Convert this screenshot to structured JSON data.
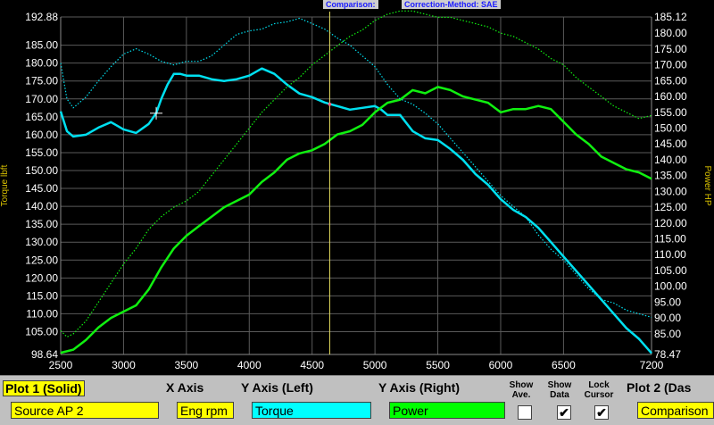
{
  "header": {
    "comparison_label": "Comparison:",
    "correction_label": "Correction-Method: SAE"
  },
  "colors": {
    "torque": "#00e0f0",
    "power": "#10f010",
    "cursor": "#e8e060",
    "grid": "#5a5a5a",
    "axis_label": "#d8c000"
  },
  "chart_data": {
    "type": "line",
    "xlim": [
      2500,
      7200
    ],
    "y_left_lim": [
      98.64,
      192.88
    ],
    "y_right_lim": [
      78.47,
      185.12
    ],
    "x_ticks": [
      2500,
      3000,
      3500,
      4000,
      4500,
      5000,
      5500,
      6000,
      6500,
      7200
    ],
    "y_left_ticks": [
      "192.88",
      "185.00",
      "180.00",
      "175.00",
      "170.00",
      "165.00",
      "160.00",
      "155.00",
      "150.00",
      "145.00",
      "140.00",
      "135.00",
      "130.00",
      "125.00",
      "120.00",
      "115.00",
      "110.00",
      "105.00",
      "98.64"
    ],
    "y_right_ticks": [
      "185.12",
      "180.00",
      "175.00",
      "170.00",
      "165.00",
      "160.00",
      "155.00",
      "150.00",
      "145.00",
      "140.00",
      "135.00",
      "130.00",
      "125.00",
      "120.00",
      "115.00",
      "110.00",
      "105.00",
      "100.00",
      "95.00",
      "90.00",
      "85.00",
      "78.47"
    ],
    "y_left_label": "Torque lbft",
    "y_right_label": "Power HP",
    "cursor_x": 4640,
    "grid": true,
    "series": [
      {
        "name": "Torque",
        "axis": "left",
        "style": "solid",
        "color": "#00e0f0",
        "x": [
          2500,
          2550,
          2600,
          2700,
          2800,
          2900,
          3000,
          3100,
          3200,
          3260,
          3300,
          3350,
          3400,
          3450,
          3500,
          3600,
          3700,
          3800,
          3900,
          4000,
          4100,
          4200,
          4300,
          4400,
          4500,
          4600,
          4700,
          4800,
          4900,
          5000,
          5050,
          5100,
          5200,
          5300,
          5400,
          5500,
          5600,
          5700,
          5800,
          5900,
          6000,
          6100,
          6200,
          6300,
          6400,
          6500,
          6600,
          6700,
          6800,
          6900,
          7000,
          7100,
          7200
        ],
        "y": [
          166.5,
          161,
          159.5,
          160,
          162,
          163.5,
          161.5,
          160.5,
          163,
          166,
          170,
          174,
          177,
          177,
          176.5,
          176.5,
          175.5,
          175,
          175.5,
          176.5,
          178.5,
          177,
          174,
          171.5,
          170.5,
          169,
          168,
          167,
          167.5,
          168,
          167,
          165.5,
          165.5,
          161,
          159,
          158.5,
          156,
          153,
          149,
          146,
          142,
          139,
          137,
          134,
          130,
          126,
          122,
          118,
          114,
          110,
          106,
          103,
          99
        ]
      },
      {
        "name": "Power",
        "axis": "right",
        "style": "solid",
        "color": "#10f010",
        "x": [
          2500,
          2600,
          2700,
          2800,
          2900,
          3000,
          3100,
          3200,
          3300,
          3400,
          3500,
          3600,
          3700,
          3800,
          3900,
          4000,
          4100,
          4200,
          4300,
          4400,
          4500,
          4600,
          4700,
          4800,
          4900,
          5000,
          5100,
          5200,
          5300,
          5400,
          5500,
          5600,
          5700,
          5800,
          5900,
          6000,
          6100,
          6200,
          6300,
          6400,
          6500,
          6600,
          6700,
          6800,
          6900,
          7000,
          7100,
          7200
        ],
        "y": [
          79,
          80,
          83,
          87,
          90,
          92,
          94,
          99,
          106,
          112,
          116,
          119,
          122,
          125,
          127,
          129,
          133,
          136,
          140,
          142,
          143,
          145,
          148,
          149,
          151,
          155,
          158,
          159,
          162,
          161,
          163,
          162,
          160,
          159,
          158,
          155,
          156,
          156,
          157,
          156,
          152,
          148,
          145,
          141,
          139,
          137,
          136,
          134
        ]
      },
      {
        "name": "",
        "axis": "left",
        "style": "dotted",
        "color": "#00e0f0",
        "x": [
          2500,
          2550,
          2600,
          2700,
          2800,
          2900,
          3000,
          3100,
          3200,
          3300,
          3400,
          3500,
          3600,
          3700,
          3800,
          3900,
          4000,
          4100,
          4200,
          4300,
          4400,
          4500,
          4600,
          4700,
          4800,
          4900,
          5000,
          5100,
          5200,
          5300,
          5400,
          5500,
          5600,
          5700,
          5800,
          5900,
          6000,
          6100,
          6200,
          6300,
          6400,
          6500,
          6600,
          6700,
          6800,
          6900,
          7000,
          7100,
          7200
        ],
        "y": [
          180,
          170,
          167.5,
          170.5,
          175,
          179,
          182.5,
          184,
          182.5,
          180.5,
          179.5,
          180.5,
          180.5,
          182,
          185,
          188,
          189,
          189.5,
          191,
          191.5,
          192.5,
          191,
          189.5,
          187,
          185,
          182,
          179,
          174,
          170,
          168.5,
          166,
          163,
          159,
          155,
          151,
          147,
          143,
          140,
          137,
          132,
          128,
          125,
          121,
          117,
          114,
          113,
          111,
          110,
          109
        ]
      },
      {
        "name": "",
        "axis": "right",
        "style": "dotted",
        "color": "#10f010",
        "x": [
          2500,
          2550,
          2600,
          2700,
          2800,
          2900,
          3000,
          3100,
          3200,
          3300,
          3400,
          3500,
          3600,
          3700,
          3800,
          3900,
          4000,
          4100,
          4200,
          4300,
          4400,
          4500,
          4600,
          4700,
          4800,
          4900,
          5000,
          5100,
          5200,
          5300,
          5400,
          5500,
          5600,
          5700,
          5800,
          5900,
          6000,
          6100,
          6200,
          6300,
          6400,
          6500,
          6600,
          6700,
          6800,
          6900,
          7000,
          7100,
          7200
        ],
        "y": [
          86,
          84,
          85,
          89,
          95,
          101,
          107,
          112,
          118,
          122,
          125,
          127,
          130,
          135,
          140,
          145,
          150,
          155,
          159,
          163,
          166,
          170,
          173,
          176,
          179,
          181,
          184,
          186,
          187,
          187,
          186,
          185,
          185,
          184,
          183,
          182,
          180,
          179,
          177,
          175,
          172,
          170,
          166,
          163,
          160,
          157,
          155,
          153,
          154
        ]
      }
    ]
  },
  "controls": {
    "plot1_title": "Plot 1 (Solid)",
    "x_axis_title": "X Axis",
    "y_left_title": "Y Axis (Left)",
    "y_right_title": "Y Axis (Right)",
    "show_ave_label": "Show Ave.",
    "show_data_label": "Show Data",
    "lock_cursor_label": "Lock Cursor",
    "plot2_title": "Plot 2 (Das",
    "plot1_source": "Source AP 2",
    "x_axis_value": "Eng rpm",
    "y_left_value": "Torque",
    "y_right_value": "Power",
    "plot2_source": "Comparison",
    "show_ave_checked": false,
    "show_data_checked": true,
    "lock_cursor_checked": true,
    "check_mark": "✔"
  }
}
